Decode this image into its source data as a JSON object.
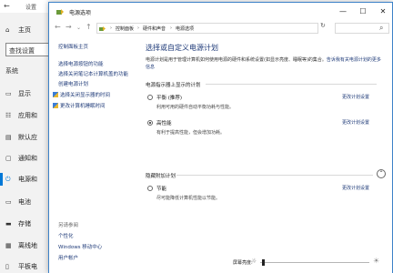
{
  "settings": {
    "title": "设置",
    "home": "主页",
    "search_placeholder": "查找设置",
    "section": "系统",
    "nav": [
      {
        "label": "显示",
        "icon": "monitor-icon"
      },
      {
        "label": "应用和",
        "icon": "apps-icon"
      },
      {
        "label": "默认应",
        "icon": "default-apps-icon"
      },
      {
        "label": "通知和",
        "icon": "notifications-icon"
      },
      {
        "label": "电源和",
        "icon": "power-icon"
      },
      {
        "label": "电池",
        "icon": "battery-icon"
      },
      {
        "label": "存储",
        "icon": "storage-icon"
      },
      {
        "label": "离线地",
        "icon": "offline-maps-icon"
      },
      {
        "label": "平板电",
        "icon": "tablet-icon"
      }
    ]
  },
  "window": {
    "title": "电源选项",
    "controls": {
      "minimize": "—",
      "maximize": "☐",
      "close": "✕"
    }
  },
  "address": {
    "crumbs": [
      "控制面板",
      "硬件和声音",
      "电源选项"
    ],
    "search_placeholder": ""
  },
  "left_pane": {
    "home": "控制面板主页",
    "links": [
      "选择电源按钮的功能",
      "选择关闭笔记本计算机盖的功能",
      "创建电源计划",
      "选择关闭显示器的时间",
      "更改计算机睡眠时间"
    ],
    "see_also": "另请参阅",
    "see_also_links": [
      "个性化",
      "Windows 移动中心",
      "用户帐户"
    ]
  },
  "main": {
    "heading": "选择或自定义电源计划",
    "desc": "电源计划是用于管理计算机如何使用电源的硬件和系统设置(如显示亮度、睡眠等)的集合。",
    "desc_link": "告诉我有关电源计划的更多信息",
    "group1": "电源指示器上显示的计划",
    "group2": "隐藏附加计划",
    "change_label": "更改计划设置",
    "plans": [
      {
        "name": "平衡 (推荐)",
        "desc": "利用可用的硬件自动平衡功耗与性能。",
        "selected": false
      },
      {
        "name": "高性能",
        "desc": "有利于提高性能，但会增加功耗。",
        "selected": true
      },
      {
        "name": "节能",
        "desc": "尽可能降低计算机性能以节能。",
        "selected": false
      }
    ]
  },
  "bottom": {
    "brightness_label": "屏幕亮度:",
    "brightness": 0.02
  }
}
